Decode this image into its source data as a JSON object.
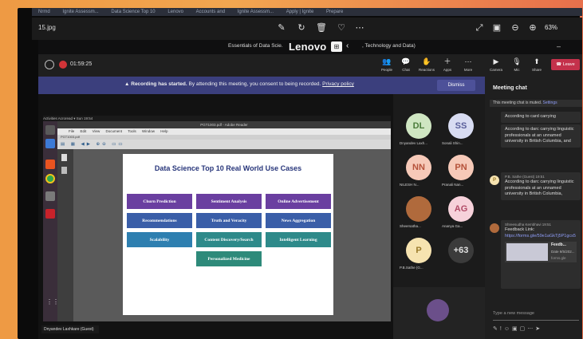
{
  "browser_tabs": [
    "Nrmd",
    "Ignite Assessm...",
    "Data Science Top 10",
    "Lenovo",
    "Accounts and",
    "Ignite Assessm...",
    "Apply | Ignite",
    "Prepare"
  ],
  "viewer": {
    "file_name": "15.jpg",
    "zoom": "63%",
    "icons": [
      "edit-icon",
      "rotate-icon",
      "delete-icon",
      "favorite-icon",
      "more-icon",
      "expand-icon",
      "slideshow-icon",
      "zoom-out-icon",
      "zoom-in-icon"
    ]
  },
  "teams": {
    "title_left": "Essentials of Data Scie.",
    "logo": "Lenovo",
    "title_right": ", Technology and Data)",
    "timer": "01:59:25",
    "header_buttons": [
      {
        "label": "People",
        "icon": "people-icon"
      },
      {
        "label": "Chat",
        "icon": "chat-icon"
      },
      {
        "label": "Reactions",
        "icon": "reactions-icon"
      },
      {
        "label": "Apps",
        "icon": "apps-icon"
      },
      {
        "label": "More",
        "icon": "more-icon"
      }
    ],
    "control_buttons": [
      {
        "label": "Camera",
        "icon": "camera-icon"
      },
      {
        "label": "Mic",
        "icon": "mic-icon"
      },
      {
        "label": "Share",
        "icon": "share-icon"
      }
    ],
    "leave_label": "Leave",
    "banner": {
      "lead": "Recording has started.",
      "text": "By attending this meeting, you consent to being recorded.",
      "link": "Privacy policy",
      "dismiss": "Dismiss"
    }
  },
  "shared_screen": {
    "topbar": "Activities   Acroread ▾                                  Sun 19:54",
    "window_title": "PGT1003.pdf - Adobe Reader",
    "menu": [
      "File",
      "Edit",
      "View",
      "Document",
      "Tools",
      "Window",
      "Help"
    ],
    "tab": "PGT1003.pdf",
    "slide": {
      "title": "Data Science Top 10 Real World Use Cases",
      "cases": [
        {
          "label": "Churn Prediction",
          "color": "#6a3fa0"
        },
        {
          "label": "Sentiment Analysis",
          "color": "#6a3fa0"
        },
        {
          "label": "Online Advertisement",
          "color": "#6a3fa0"
        },
        {
          "label": "Recommendations",
          "color": "#3a5ea8"
        },
        {
          "label": "Truth and Veracity",
          "color": "#3a5ea8"
        },
        {
          "label": "News Aggregation",
          "color": "#3a5ea8"
        },
        {
          "label": "Scalability",
          "color": "#2e7fb0"
        },
        {
          "label": "Content Discovery/Search",
          "color": "#2e8a8a"
        },
        {
          "label": "Intelligent Learning",
          "color": "#2e8a8a"
        },
        {
          "label": "Personalized Medicine",
          "color": "#2e8a7a"
        }
      ]
    }
  },
  "participants": [
    {
      "initials": "DL",
      "name": "Dnyandev Laxh...",
      "bg": "#cfe6c2",
      "fg": "#4a7a3a"
    },
    {
      "initials": "SS",
      "name": "Sonali Shin...",
      "bg": "#d8dcf2",
      "fg": "#5a5f9a"
    },
    {
      "initials": "NN",
      "name": "NILESH N...",
      "bg": "#f6c9b8",
      "fg": "#b5523a"
    },
    {
      "initials": "PN",
      "name": "Pranali Nan...",
      "bg": "#f6c9b8",
      "fg": "#b5523a"
    },
    {
      "initials": "",
      "name": "Sheersatha...",
      "bg": "#b06a3c",
      "fg": "#ffffff"
    },
    {
      "initials": "AG",
      "name": "Ananya Ga...",
      "bg": "#f6d1da",
      "fg": "#b04a66"
    },
    {
      "initials": "P",
      "name": "P.B.Sathe (G...",
      "bg": "#f6e3b0",
      "fg": "#9a7a2a"
    },
    {
      "initials": "+63",
      "name": "",
      "bg": "#3b3b3b",
      "fg": "#e0e0e0"
    }
  ],
  "presenter_tag": "Dnyandev Laxhkare (Guest)",
  "chat": {
    "title": "Meeting chat",
    "mute_note": "This meeting chat is muted.",
    "mute_link": "Settings",
    "messages": [
      {
        "text": "According to card carrying"
      },
      {
        "text": "According to darc carrying linguistic professionals at an unnamed university in British Columbia, and"
      },
      {
        "author": "P.B. Sathe (Guest)",
        "time": "19:51",
        "text": "According to darc carrying linguistic professionals at an unnamed university in British Columbia,"
      },
      {
        "author": "Shreesudha Kembhavi",
        "time": "19:51",
        "text": "Feedback Link:",
        "link": "https://forms.gle/59e1aGkTj5P1gcs5"
      }
    ],
    "preview_card": {
      "title": "Feedb...",
      "subtitle": "Date 9/5/202...",
      "source": "forms.gle"
    },
    "compose_placeholder": "Type a new message"
  }
}
